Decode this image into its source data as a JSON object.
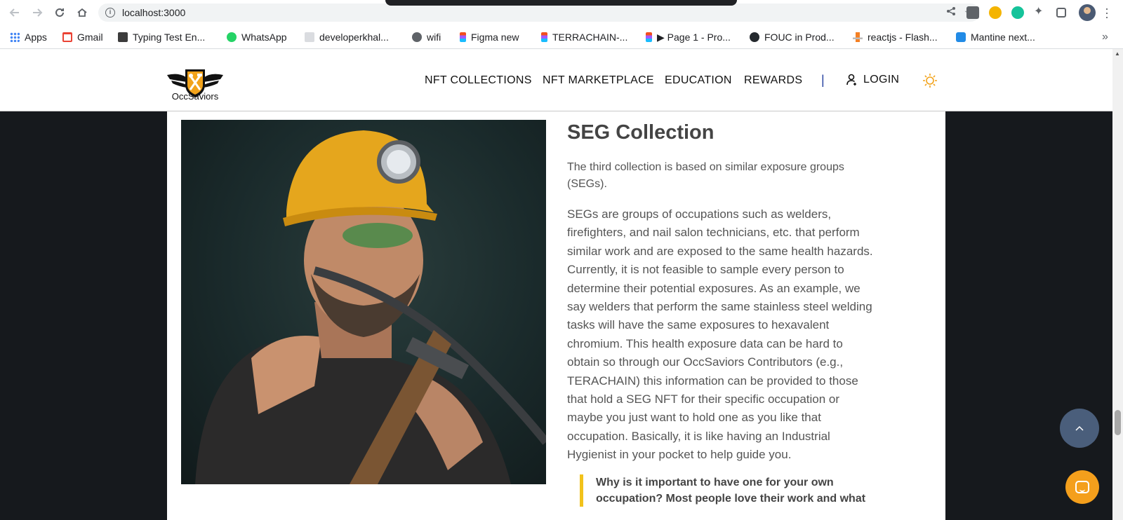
{
  "browser": {
    "url": "localhost:3000",
    "bookmarks": [
      {
        "label": "Apps",
        "icon": "apps-grid-icon",
        "color": "#4285f4"
      },
      {
        "label": "Gmail",
        "icon": "gmail-icon",
        "color": "#ea4335"
      },
      {
        "label": "Typing Test En...",
        "icon": "typing-test-icon",
        "color": "#3c3c3c"
      },
      {
        "label": "WhatsApp",
        "icon": "whatsapp-icon",
        "color": "#25d366"
      },
      {
        "label": "developerkhal...",
        "icon": "site-icon",
        "color": "#9aa0a6"
      },
      {
        "label": "wifi",
        "icon": "globe-icon",
        "color": "#5f6368"
      },
      {
        "label": "Figma new",
        "icon": "figma-icon",
        "color": "#f24e1e"
      },
      {
        "label": "TERRACHAIN-...",
        "icon": "figma-icon",
        "color": "#f24e1e"
      },
      {
        "label": "▶ Page 1 - Pro...",
        "icon": "figma-icon",
        "color": "#a259ff"
      },
      {
        "label": "FOUC in Prod...",
        "icon": "github-icon",
        "color": "#24292e"
      },
      {
        "label": "reactjs - Flash...",
        "icon": "stackoverflow-icon",
        "color": "#f48024"
      },
      {
        "label": "Mantine next...",
        "icon": "react-icon",
        "color": "#228be6"
      }
    ],
    "more_label": "»"
  },
  "site": {
    "logo_text": "OccSaviors",
    "nav": {
      "nft_collections": "NFT COLLECTIONS",
      "nft_marketplace": "NFT MARKETPLACE",
      "education": "EDUCATION",
      "rewards": "REWARDS",
      "separator": "|",
      "login": "LOGIN"
    },
    "accent_color": "#f2c21b",
    "nav_separator_color": "#2540a0"
  },
  "content": {
    "title": "SEG Collection",
    "intro": "The third collection is based on similar exposure groups (SEGs).",
    "body": "SEGs are groups of occupations such as welders, firefighters, and nail salon technicians, etc. that perform similar work and are exposed to the same health hazards. Currently, it is not feasible to sample every person to determine their potential exposures. As an example, we say welders that perform the same stainless steel welding tasks will have the same exposures to hexavalent chromium. This health exposure data can be hard to obtain so through our OccSaviors Contributors (e.g., TERACHAIN) this information can be provided to those that hold a SEG NFT for their specific occupation or maybe you just want to hold one as you like that occupation. Basically, it is like having an Industrial Hygienist in your pocket to help guide you.",
    "quote": "Why is it important to have one for your own occupation? Most people love their work and what"
  },
  "widgets": {
    "scroll_top_color": "#4a5e7b",
    "chat_color": "#f49f1c"
  }
}
